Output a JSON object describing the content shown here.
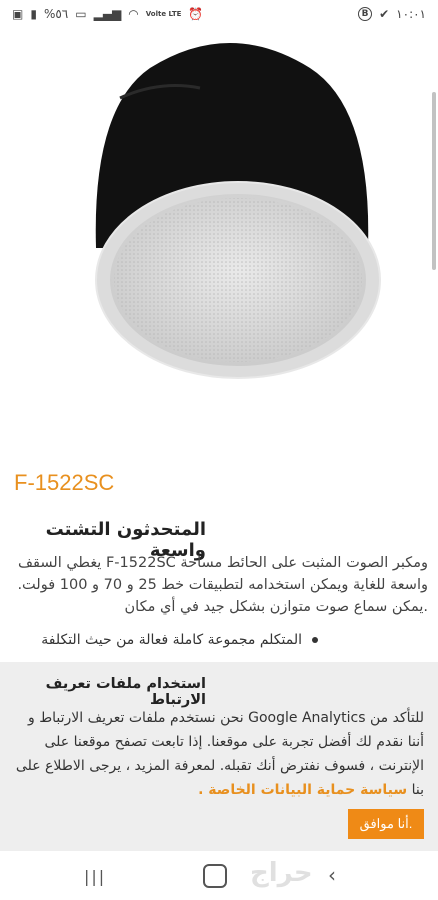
{
  "status_bar": {
    "time": "١٠:٠١",
    "battery": "%٥٦",
    "network": "Volte LTE"
  },
  "product": {
    "model": "F-1522SC",
    "heading": "المتحدثون التشتت واسعة",
    "description": "ومكبر الصوت المثبت على الحائط مساحة F-1522SC يغطي السقف واسعة للغاية ويمكن استخدامه لتطبيقات خط 25 و 70 و 100 فولت. .يمكن سماع صوت متوازن بشكل جيد في أي مكان",
    "bullet": "المتكلم مجموعة كاملة فعالة من حيث التكلفة"
  },
  "cookie": {
    "title": "استخدام ملفات تعريف الارتباط",
    "text": "للتأكد من Google Analytics نحن نستخدم ملفات تعريف الارتباط و أننا نقدم لك أفضل تجربة على موقعنا. إذا تابعت تصفح موقعنا على الإنترنت ، فسوف نفترض أنك تقبله. لمعرفة المزيد ، يرجى الاطلاع على بنا",
    "link": "سياسة حماية البيانات الخاصة .",
    "button": ".أنا موافق"
  },
  "watermark": "حراج",
  "colors": {
    "accent": "#e8901f",
    "banner_bg": "#eeeeee"
  }
}
